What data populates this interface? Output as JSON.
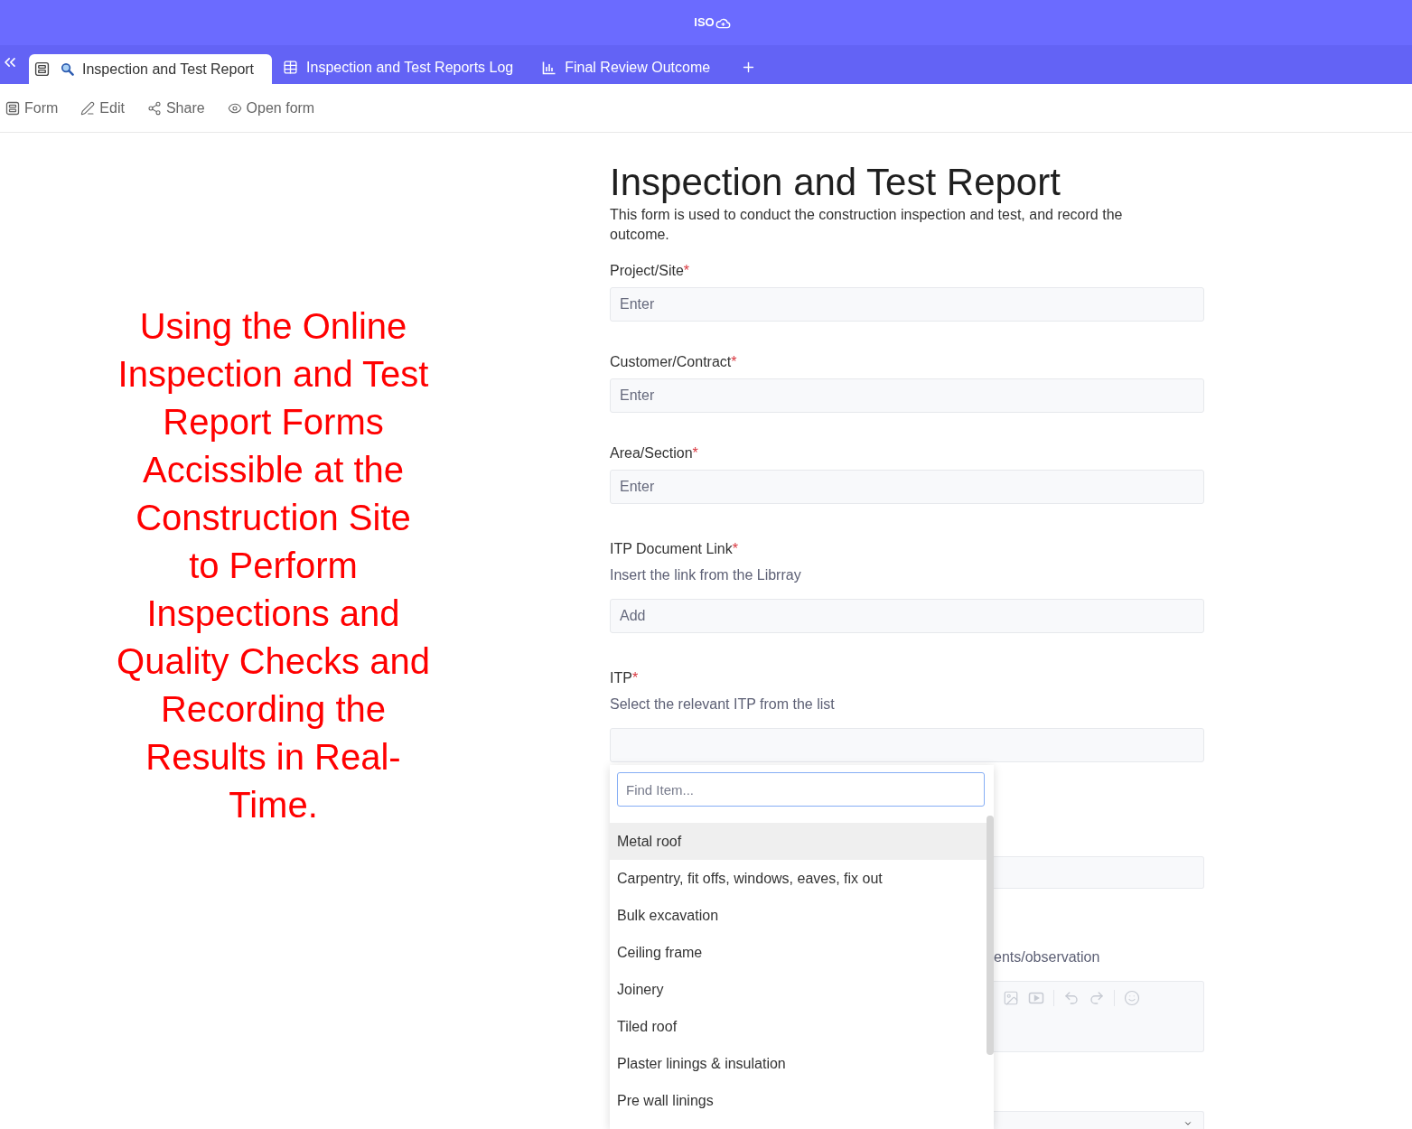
{
  "app_bar": {
    "logo_text": "ISO"
  },
  "tabs": [
    {
      "label": "Inspection and Test Report",
      "kind": "form",
      "selected": true
    },
    {
      "label": "Inspection and Test Reports Log",
      "kind": "table",
      "selected": false
    },
    {
      "label": "Final Review Outcome",
      "kind": "chart",
      "selected": false
    }
  ],
  "toolbar": [
    {
      "label": "Form",
      "kind": "form"
    },
    {
      "label": "Edit",
      "kind": "edit"
    },
    {
      "label": "Share",
      "kind": "share"
    },
    {
      "label": "Open form",
      "kind": "view"
    }
  ],
  "caption": {
    "lines": [
      "Using the Online",
      "Inspection and Test",
      "Report Forms",
      "Accissible at the",
      "Construction Site",
      "to Perform",
      "Inspections and",
      "Quality Checks and",
      "Recording the",
      "Results in Real-",
      "Time."
    ]
  },
  "form": {
    "title": "Inspection and Test Report",
    "description": "This form is used to conduct the construction inspection and test, and record the outcome.",
    "fields": [
      {
        "label": "Project/Site",
        "mark": "*",
        "placeholder": "Enter"
      },
      {
        "label": "Customer/Contract",
        "mark": "*",
        "placeholder": "Enter"
      },
      {
        "label": "Area/Section",
        "mark": "*",
        "placeholder": "Enter"
      },
      {
        "label": "ITP Document Link",
        "mark": "*",
        "help": "Insert the link from the Librray",
        "placeholder": "Add"
      },
      {
        "label": "ITP",
        "mark": "*",
        "help": "Select the relevant ITP from the list"
      }
    ],
    "partly_covered": [
      {
        "kind": "text_input"
      },
      {
        "kind": "rich_text",
        "label": "ents/observation"
      },
      {
        "kind": "select"
      }
    ]
  },
  "dropdown": {
    "search_placeholder": "Find Item...",
    "items": [
      {
        "label": "Metal roof",
        "selected": true
      },
      {
        "label": "Carpentry, fit offs, windows, eaves, fix out",
        "selected": false
      },
      {
        "label": "Bulk excavation",
        "selected": false
      },
      {
        "label": "Ceiling frame",
        "selected": false
      },
      {
        "label": "Joinery",
        "selected": false
      },
      {
        "label": "Tiled roof",
        "selected": false
      },
      {
        "label": "Plaster linings & insulation",
        "selected": false
      },
      {
        "label": "Pre wall linings",
        "selected": false
      }
    ]
  }
}
